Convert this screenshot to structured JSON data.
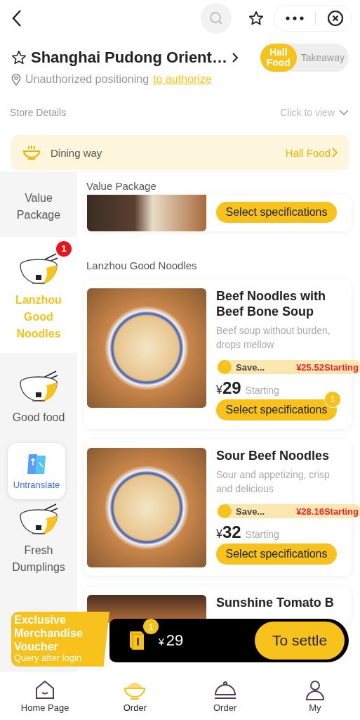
{
  "store": {
    "name": "Shanghai Pudong Orient…",
    "favorite": false,
    "location_text": "Unauthorized positioning",
    "location_link": "to authorize",
    "modes": [
      {
        "label": "Hall Food",
        "selected": true
      },
      {
        "label": "Takeaway",
        "selected": false
      }
    ],
    "details_label": "Store Details",
    "details_action": "Click to view"
  },
  "dining_way": {
    "label": "Dining way",
    "value": "Hall Food"
  },
  "sidebar": {
    "items": [
      {
        "label": "Value Package",
        "selected": false
      },
      {
        "label": "Lanzhou Good Noodles",
        "selected": true,
        "badge": "1"
      },
      {
        "label": "Good food",
        "selected": false
      },
      {
        "label": "Fresh Dumplings",
        "selected": false
      }
    ],
    "translate_button": "Untranslate"
  },
  "sections": [
    {
      "title": "Value Package",
      "dishes": [
        {
          "kind": "partial",
          "button": "Select specifications"
        }
      ]
    },
    {
      "title": "Lanzhou Good Noodles",
      "dishes": [
        {
          "kind": "full",
          "name": "Beef Noodles with Beef Bone Soup",
          "description": "Beef soup without burden, drops mellow",
          "promo_label": "Save...",
          "promo_price": "¥25.52Starting",
          "currency": "¥",
          "price": "29",
          "price_suffix": "Starting",
          "button": "Select specifications",
          "count": "1"
        },
        {
          "kind": "full",
          "name": "Sour Beef Noodles",
          "description": "Sour and appetizing, crisp and delicious",
          "promo_label": "Save...",
          "promo_price": "¥28.16Starting",
          "currency": "¥",
          "price": "32",
          "price_suffix": "Starting",
          "button": "Select specifications"
        },
        {
          "kind": "top",
          "name": "Sunshine Tomato B"
        }
      ]
    }
  ],
  "voucher": {
    "title": "Exclusive Merchandise Voucher",
    "subtitle": "Query after login"
  },
  "cart": {
    "count": "1",
    "currency": "¥",
    "total": "29",
    "button": "To settle"
  },
  "tab_bar": [
    {
      "label": "Home Page",
      "kind": "home",
      "selected": false
    },
    {
      "label": "Order",
      "kind": "bowl",
      "selected": true
    },
    {
      "label": "Order",
      "kind": "cloche",
      "selected": false
    },
    {
      "label": "My",
      "kind": "person",
      "selected": false
    }
  ]
}
